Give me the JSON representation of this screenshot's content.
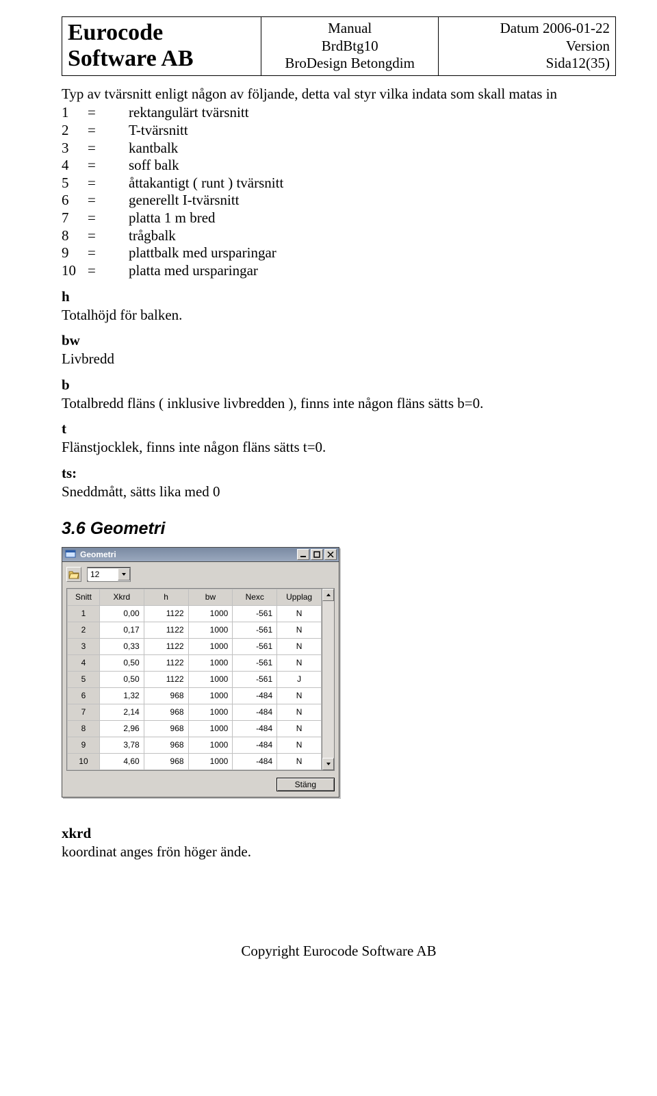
{
  "header": {
    "company_line1": "Eurocode",
    "company_line2": "Software AB",
    "mid_line1": "Manual",
    "mid_line2": "BrdBtg10",
    "mid_line3": "BroDesign Betongdim",
    "right_line1": "Datum 2006-01-22",
    "right_line2": "Version",
    "right_line3": "Sida12(35)"
  },
  "intro": "Typ av tvärsnitt enligt någon av följande, detta val styr vilka indata som skall matas in",
  "defs": [
    {
      "n": "1",
      "eq": "=",
      "t": "rektangulärt tvärsnitt"
    },
    {
      "n": "2",
      "eq": "=",
      "t": "T-tvärsnitt"
    },
    {
      "n": "3",
      "eq": "=",
      "t": "kantbalk"
    },
    {
      "n": "4",
      "eq": "=",
      "t": "soff balk"
    },
    {
      "n": "5",
      "eq": "=",
      "t": "åttakantigt ( runt ) tvärsnitt"
    },
    {
      "n": "6",
      "eq": "=",
      "t": "generellt I-tvärsnitt"
    },
    {
      "n": "7",
      "eq": "=",
      "t": "platta 1 m bred"
    },
    {
      "n": "8",
      "eq": "=",
      "t": "trågbalk"
    },
    {
      "n": "9",
      "eq": "=",
      "t": "plattbalk med ursparingar"
    },
    {
      "n": "10",
      "eq": "=",
      "t": "platta med ursparingar"
    }
  ],
  "terms": {
    "h": {
      "label": "h",
      "text": "Totalhöjd för balken."
    },
    "bw": {
      "label": "bw",
      "text": "Livbredd"
    },
    "b": {
      "label": "b",
      "text": "Totalbredd fläns ( inklusive livbredden ), finns inte någon fläns sätts b=0."
    },
    "t": {
      "label": "t",
      "text": "Flänstjocklek, finns inte någon fläns sätts t=0."
    },
    "ts": {
      "label": "ts:",
      "text": "Sneddmått, sätts lika med 0"
    }
  },
  "section_geometri": "3.6  Geometri",
  "window": {
    "title": "Geometri",
    "combo_value": "12",
    "columns": [
      "Snitt",
      "Xkrd",
      "h",
      "bw",
      "Nexc",
      "Upplag"
    ],
    "rows": [
      {
        "snitt": "1",
        "xkrd": "0,00",
        "h": "1122",
        "bw": "1000",
        "nexc": "-561",
        "upp": "N"
      },
      {
        "snitt": "2",
        "xkrd": "0,17",
        "h": "1122",
        "bw": "1000",
        "nexc": "-561",
        "upp": "N"
      },
      {
        "snitt": "3",
        "xkrd": "0,33",
        "h": "1122",
        "bw": "1000",
        "nexc": "-561",
        "upp": "N"
      },
      {
        "snitt": "4",
        "xkrd": "0,50",
        "h": "1122",
        "bw": "1000",
        "nexc": "-561",
        "upp": "N"
      },
      {
        "snitt": "5",
        "xkrd": "0,50",
        "h": "1122",
        "bw": "1000",
        "nexc": "-561",
        "upp": "J"
      },
      {
        "snitt": "6",
        "xkrd": "1,32",
        "h": "968",
        "bw": "1000",
        "nexc": "-484",
        "upp": "N"
      },
      {
        "snitt": "7",
        "xkrd": "2,14",
        "h": "968",
        "bw": "1000",
        "nexc": "-484",
        "upp": "N"
      },
      {
        "snitt": "8",
        "xkrd": "2,96",
        "h": "968",
        "bw": "1000",
        "nexc": "-484",
        "upp": "N"
      },
      {
        "snitt": "9",
        "xkrd": "3,78",
        "h": "968",
        "bw": "1000",
        "nexc": "-484",
        "upp": "N"
      },
      {
        "snitt": "10",
        "xkrd": "4,60",
        "h": "968",
        "bw": "1000",
        "nexc": "-484",
        "upp": "N"
      }
    ],
    "close_label": "Stäng"
  },
  "xkrd": {
    "label": "xkrd",
    "text": "koordinat anges frön höger ände."
  },
  "footer": "Copyright Eurocode Software AB"
}
